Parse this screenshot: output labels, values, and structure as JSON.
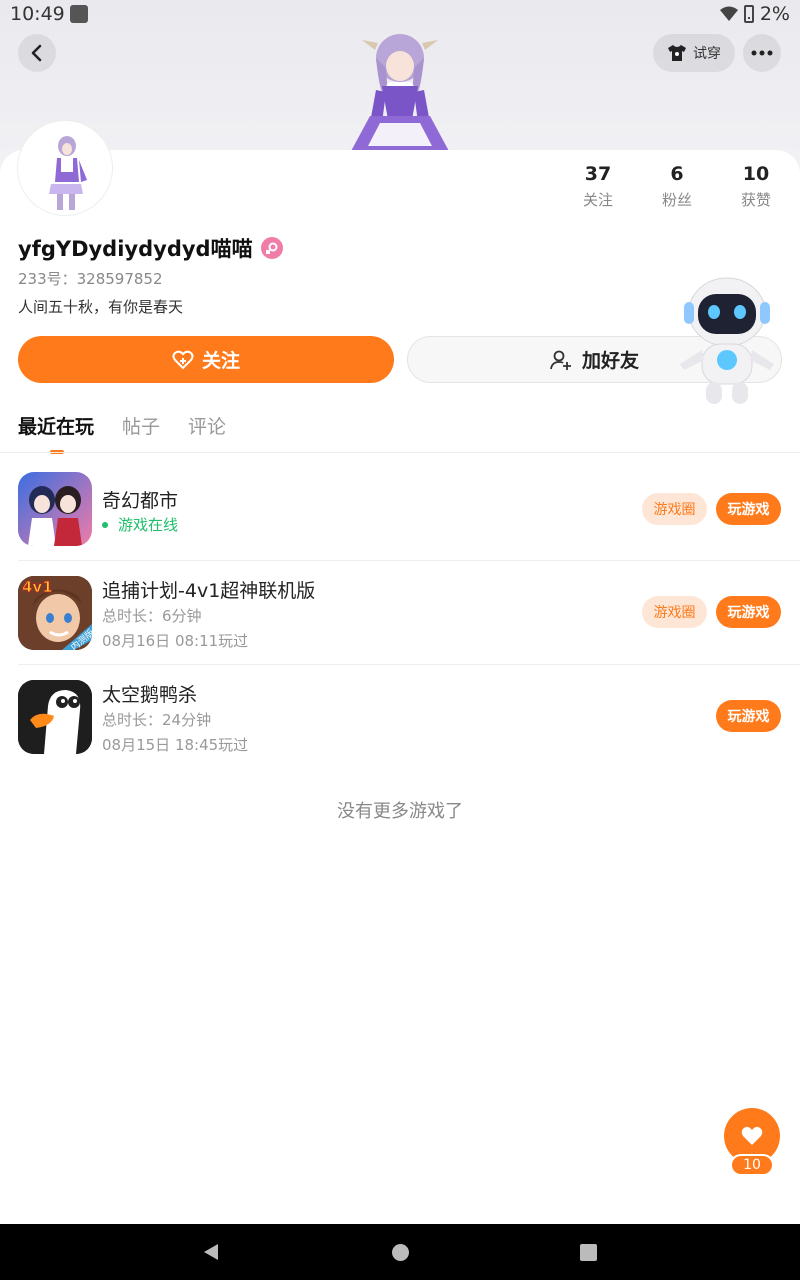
{
  "status_bar": {
    "time": "10:49",
    "battery": "2%"
  },
  "header": {
    "tryon_label": "试穿"
  },
  "profile": {
    "username": "yfgYDydiydydyd喵喵",
    "uid": "233号：328597852",
    "bio": "人间五十秋，有你是春天",
    "stats": [
      {
        "value": "37",
        "label": "关注"
      },
      {
        "value": "6",
        "label": "粉丝"
      },
      {
        "value": "10",
        "label": "获赞"
      }
    ],
    "follow_label": "关注",
    "add_friend_label": "加好友"
  },
  "tabs": [
    {
      "label": "最近在玩",
      "active": true
    },
    {
      "label": "帖子",
      "active": false
    },
    {
      "label": "评论",
      "active": false
    }
  ],
  "games": [
    {
      "name": "奇幻都市",
      "status": "游戏在线",
      "circle_label": "游戏圈",
      "play_label": "玩游戏"
    },
    {
      "name": "追捕计划-4v1超神联机版",
      "duration": "总时长：6分钟",
      "last_played": "08月16日 08:11玩过",
      "circle_label": "游戏圈",
      "play_label": "玩游戏",
      "icon_text": "4v1",
      "icon_badge": "内测版"
    },
    {
      "name": "太空鹅鸭杀",
      "duration": "总时长：24分钟",
      "last_played": "08月15日 18:45玩过",
      "play_label": "玩游戏"
    }
  ],
  "footer_text": "没有更多游戏了",
  "like": {
    "count": "10"
  },
  "colors": {
    "accent": "#ff7a1a",
    "online": "#1fbf6a",
    "gender": "#f07ca8"
  }
}
